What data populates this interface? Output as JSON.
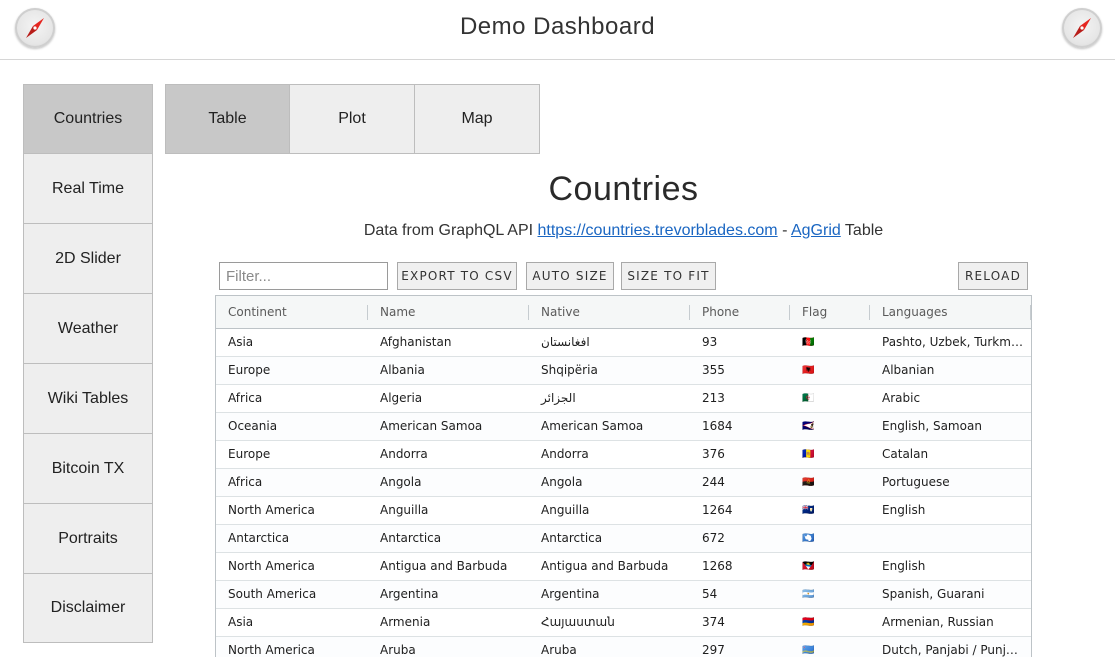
{
  "header": {
    "title": "Demo Dashboard"
  },
  "sidebar": {
    "items": [
      {
        "label": "Countries"
      },
      {
        "label": "Real Time"
      },
      {
        "label": "2D Slider"
      },
      {
        "label": "Weather"
      },
      {
        "label": "Wiki Tables"
      },
      {
        "label": "Bitcoin TX"
      },
      {
        "label": "Portraits"
      },
      {
        "label": "Disclaimer"
      }
    ],
    "active": "Countries"
  },
  "tabs": {
    "items": [
      {
        "label": "Table"
      },
      {
        "label": "Plot"
      },
      {
        "label": "Map"
      }
    ],
    "active": "Table"
  },
  "main": {
    "title": "Countries",
    "subtitle_prefix": "Data from GraphQL API ",
    "api_link": "https://countries.trevorblades.com",
    "subtitle_sep": " - ",
    "aggrid_link": "AgGrid",
    "subtitle_suffix": " Table"
  },
  "toolbar": {
    "filter_placeholder": "Filter...",
    "filter_value": "",
    "export_label": "Export to CSV",
    "autosize_label": "Auto Size",
    "fit_label": "Size to Fit",
    "reload_label": "Reload"
  },
  "grid": {
    "columns": [
      "Continent",
      "Name",
      "Native",
      "Phone",
      "Flag",
      "Languages"
    ],
    "rows": [
      {
        "continent": "Asia",
        "name": "Afghanistan",
        "native": "افغانستان",
        "phone": "93",
        "flag": "🇦🇫",
        "languages": "Pashto, Uzbek, Turkmen"
      },
      {
        "continent": "Europe",
        "name": "Albania",
        "native": "Shqipëria",
        "phone": "355",
        "flag": "🇦🇱",
        "languages": "Albanian"
      },
      {
        "continent": "Africa",
        "name": "Algeria",
        "native": "الجزائر",
        "phone": "213",
        "flag": "🇩🇿",
        "languages": "Arabic"
      },
      {
        "continent": "Oceania",
        "name": "American Samoa",
        "native": "American Samoa",
        "phone": "1684",
        "flag": "🇦🇸",
        "languages": "English, Samoan"
      },
      {
        "continent": "Europe",
        "name": "Andorra",
        "native": "Andorra",
        "phone": "376",
        "flag": "🇦🇩",
        "languages": "Catalan"
      },
      {
        "continent": "Africa",
        "name": "Angola",
        "native": "Angola",
        "phone": "244",
        "flag": "🇦🇴",
        "languages": "Portuguese"
      },
      {
        "continent": "North America",
        "name": "Anguilla",
        "native": "Anguilla",
        "phone": "1264",
        "flag": "🇦🇮",
        "languages": "English"
      },
      {
        "continent": "Antarctica",
        "name": "Antarctica",
        "native": "Antarctica",
        "phone": "672",
        "flag": "🇦🇶",
        "languages": ""
      },
      {
        "continent": "North America",
        "name": "Antigua and Barbuda",
        "native": "Antigua and Barbuda",
        "phone": "1268",
        "flag": "🇦🇬",
        "languages": "English"
      },
      {
        "continent": "South America",
        "name": "Argentina",
        "native": "Argentina",
        "phone": "54",
        "flag": "🇦🇷",
        "languages": "Spanish, Guarani"
      },
      {
        "continent": "Asia",
        "name": "Armenia",
        "native": "Հայաստան",
        "phone": "374",
        "flag": "🇦🇲",
        "languages": "Armenian, Russian"
      },
      {
        "continent": "North America",
        "name": "Aruba",
        "native": "Aruba",
        "phone": "297",
        "flag": "🇦🇼",
        "languages": "Dutch, Panjabi / Punjabi"
      }
    ]
  },
  "colors": {
    "active_nav": "#c8c8c8",
    "nav_bg": "#eeeeee",
    "link": "#1a66c2",
    "compass_needle": "#e52620"
  },
  "icons": {
    "logo": "compass-icon"
  }
}
